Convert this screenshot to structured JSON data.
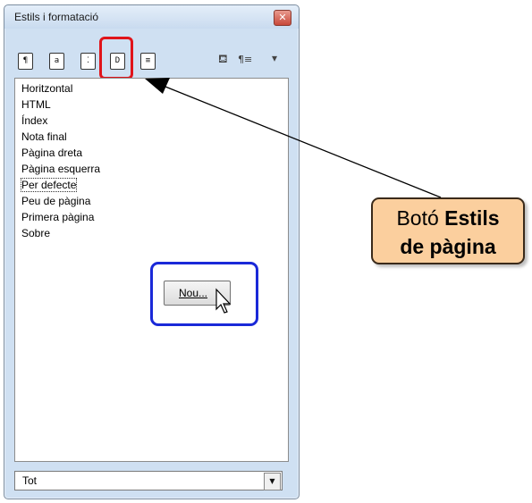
{
  "window": {
    "title": "Estils i formatació",
    "close_glyph": "✕"
  },
  "toolbar": {
    "buttons": [
      {
        "name": "paragraph-styles",
        "glyph": "¶"
      },
      {
        "name": "character-styles",
        "glyph": "a"
      },
      {
        "name": "frame-styles",
        "glyph": "⁚"
      },
      {
        "name": "page-styles",
        "glyph": "D"
      },
      {
        "name": "list-styles",
        "glyph": "≡"
      }
    ],
    "fill_format_glyph": "⛾",
    "new_style_glyph": "¶≡",
    "dropdown_glyph": "▾"
  },
  "styles_list": [
    "Horitzontal",
    "HTML",
    "Índex",
    "Nota final",
    "Pàgina dreta",
    "Pàgina esquerra",
    "Per defecte",
    "Peu de pàgina",
    "Primera pàgina",
    "Sobre"
  ],
  "selected_style": "Per defecte",
  "context_menu": {
    "new_label": "Nou..."
  },
  "filter": {
    "value": "Tot"
  },
  "callout": {
    "line1_normal": "Botó ",
    "line1_bold": "Estils",
    "line2_bold": "de pàgina"
  },
  "colors": {
    "highlight_red": "#e0141a",
    "highlight_blue": "#1a29d8",
    "callout_fill": "#fbcf9e"
  }
}
